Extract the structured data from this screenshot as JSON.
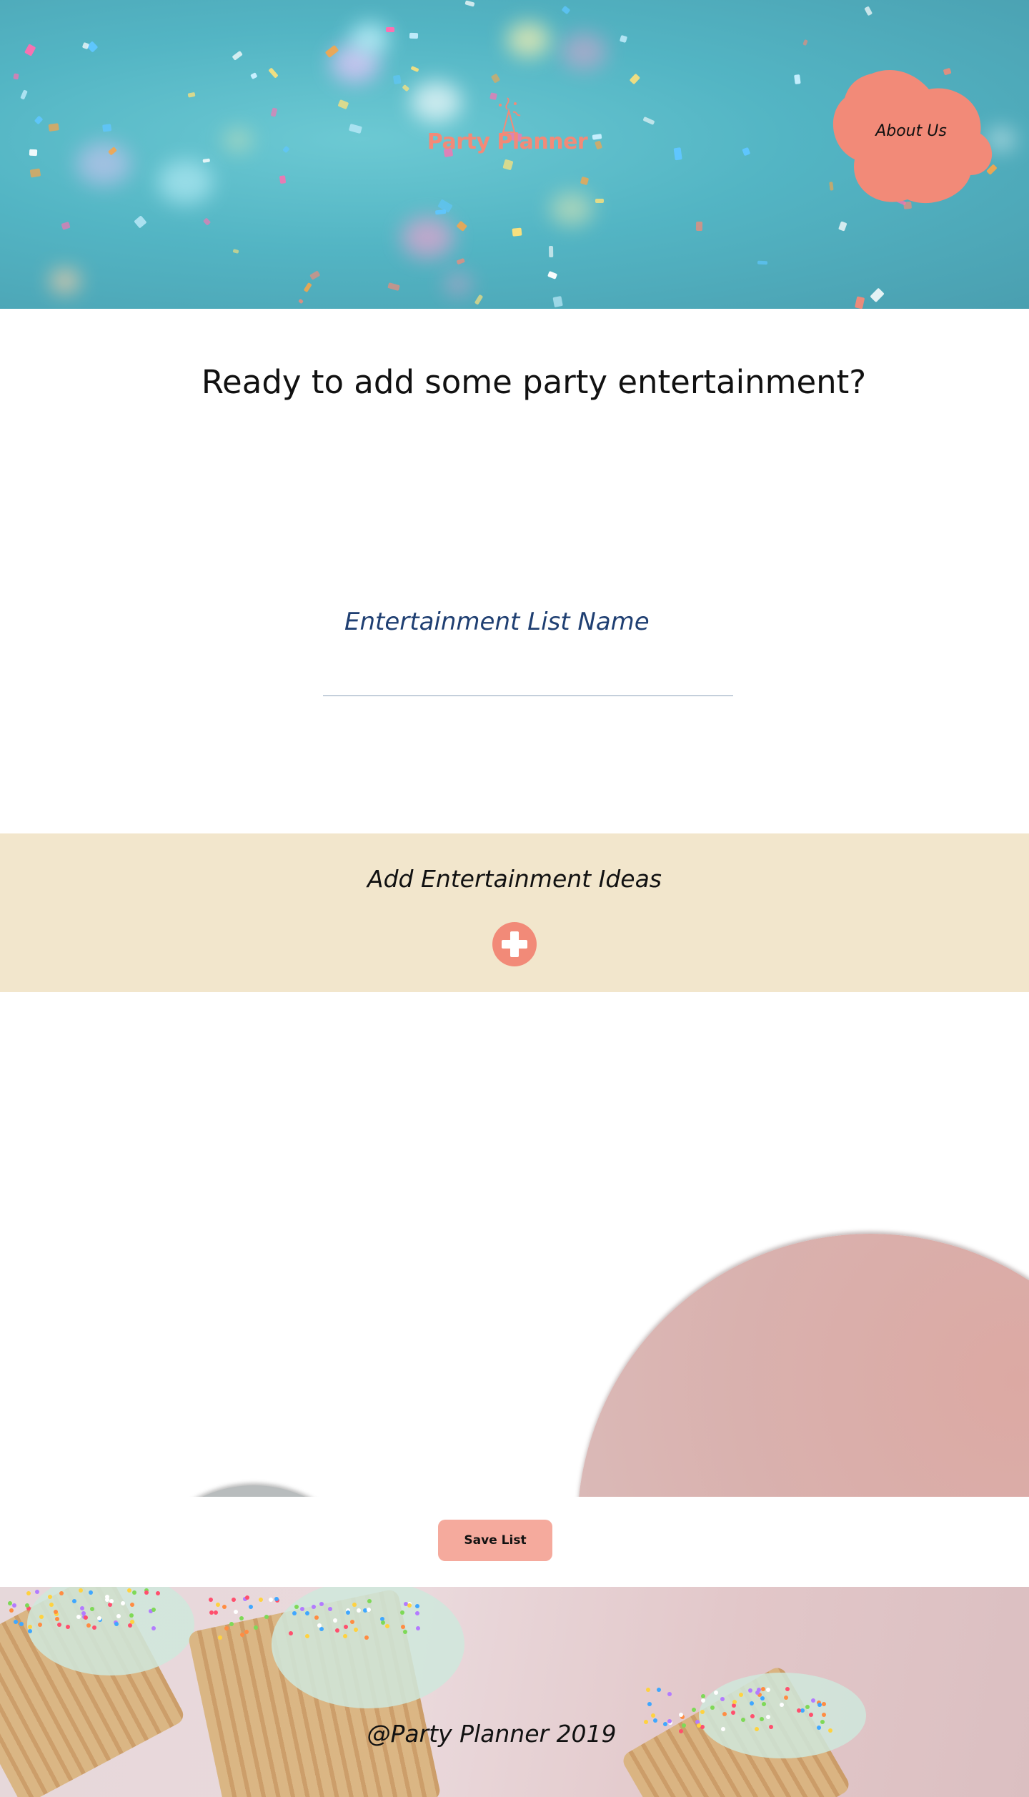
{
  "header": {
    "logo_text": "Party Planner",
    "about_label": "About Us",
    "colors": {
      "accent": "#f28a78",
      "sky": "#53b5c4"
    }
  },
  "main": {
    "title": "Ready to add some party entertainment?",
    "list_name": {
      "label": "Entertainment List Name",
      "value": ""
    },
    "ideas": {
      "label": "Add Entertainment Ideas",
      "add_icon": "plus-circle-icon"
    },
    "save_label": "Save List"
  },
  "footer": {
    "text": "@Party Planner 2019"
  }
}
